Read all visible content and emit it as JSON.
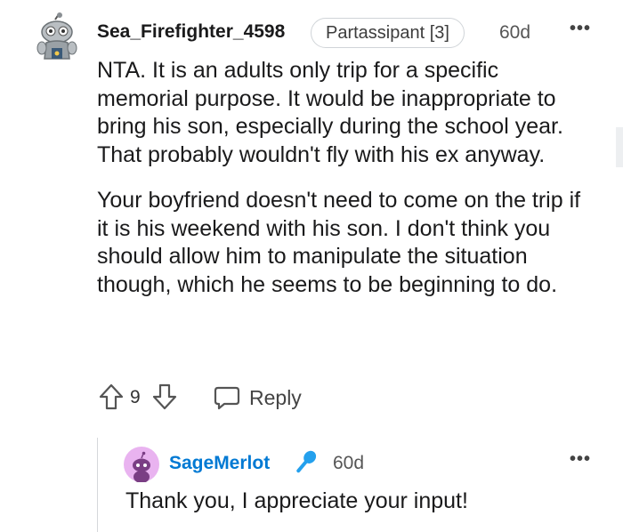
{
  "comment": {
    "author": "Sea_Firefighter_4598",
    "flair": "Partassipant [3]",
    "time": "60d",
    "more": "•••",
    "paragraphs": [
      "NTA. It is an adults only trip for a specific memorial purpose. It would be inappropriate to bring his son, especially during the school year. That probably wouldn't fly with his ex anyway.",
      "Your boyfriend doesn't need to come on the trip if it is his weekend with his son. I don't think you should allow him to manipulate the situation though, which he seems to be beginning to do."
    ],
    "score": "9",
    "reply_label": "Reply",
    "icons": {
      "avatar": "snoo-avatar-icon",
      "upvote": "arrow-up-icon",
      "downvote": "arrow-down-icon",
      "reply": "speech-bubble-icon",
      "more": "more-dots-icon"
    }
  },
  "reply": {
    "author": "SageMerlot",
    "time": "60d",
    "more": "•••",
    "text": "Thank you, I appreciate your input!",
    "icons": {
      "avatar": "snoo-avatar-icon",
      "badge": "microphone-icon",
      "more": "more-dots-icon"
    }
  },
  "colors": {
    "reply_author": "#0079d3",
    "mic": "#24a0ed",
    "reply_avatar_bg": "#e9b3f0"
  }
}
